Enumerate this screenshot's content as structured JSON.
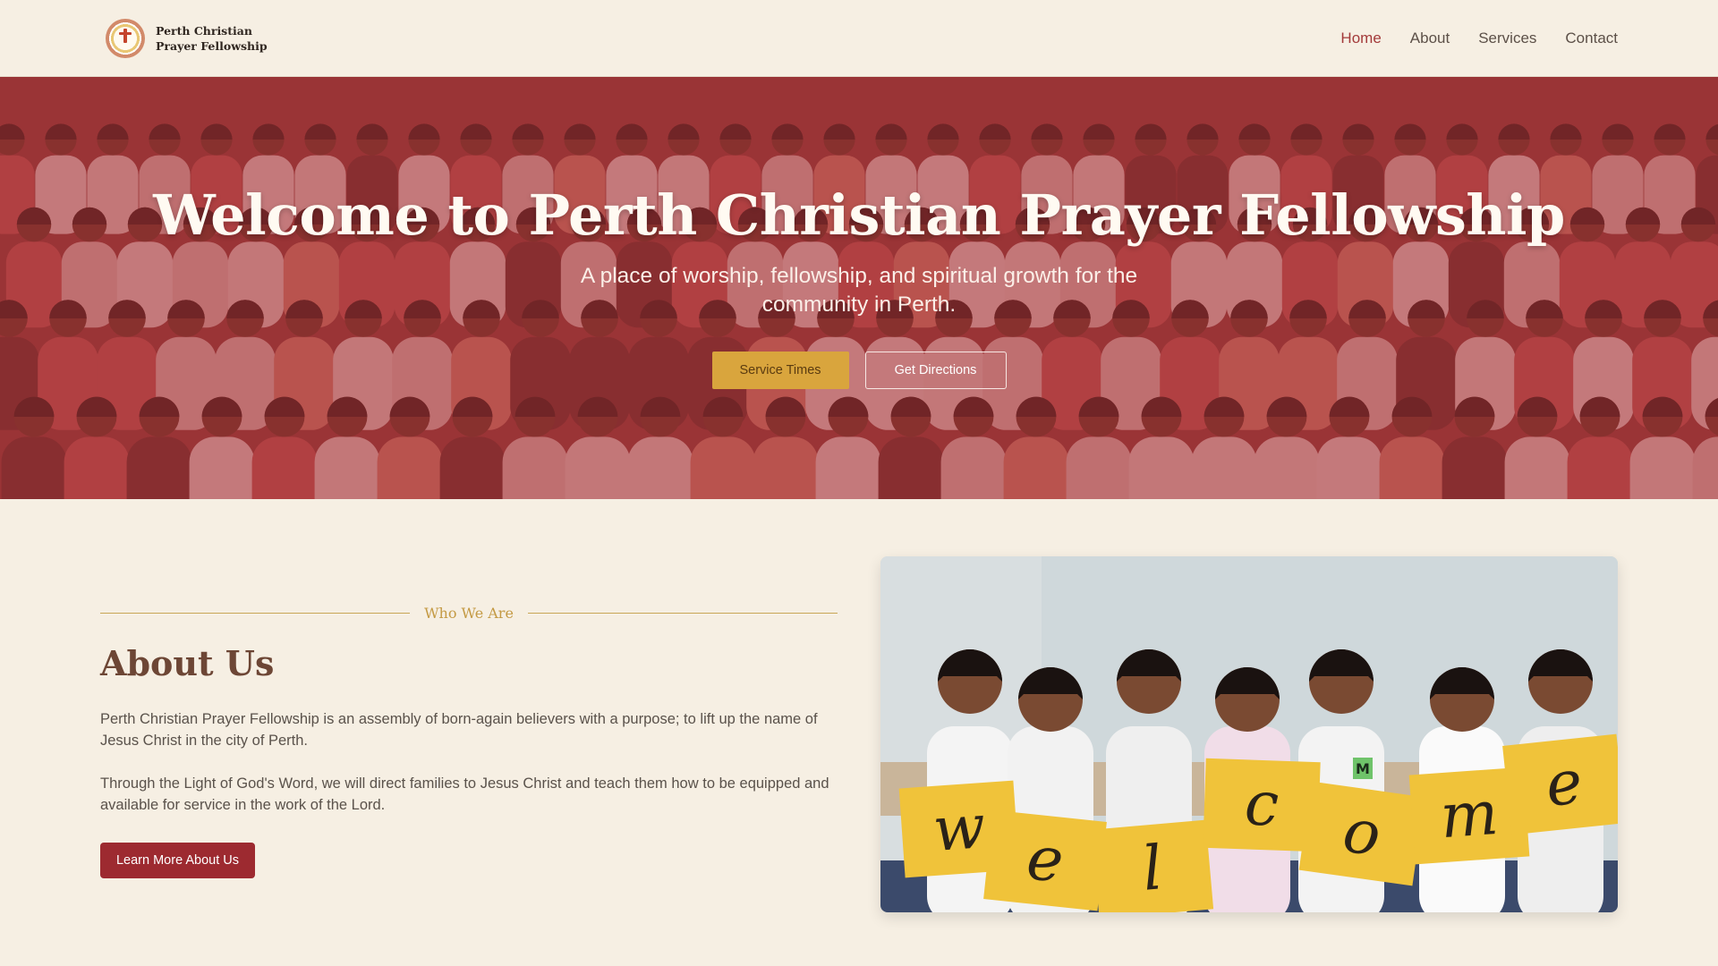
{
  "header": {
    "logo_icon": "church-seal-logo",
    "brand_line1": "Perth Christian",
    "brand_line2": "Prayer Fellowship",
    "nav": [
      {
        "label": "Home",
        "active": true
      },
      {
        "label": "About",
        "active": false
      },
      {
        "label": "Services",
        "active": false
      },
      {
        "label": "Contact",
        "active": false
      }
    ]
  },
  "hero": {
    "title": "Welcome to Perth Christian Prayer Fellowship",
    "subtitle": "A place of worship, fellowship, and spiritual growth for the community in Perth.",
    "primary_button": "Service Times",
    "secondary_button": "Get Directions",
    "overlay_color": "#a83437"
  },
  "about": {
    "eyebrow": "Who We Are",
    "title": "About Us",
    "paragraph1": "Perth Christian Prayer Fellowship is an assembly of born-again believers with a purpose; to lift up the name of Jesus Christ in the city of Perth.",
    "paragraph2": "Through the Light of God's Word, we will direct families to Jesus Christ and teach them how to be equipped and available for service in the work of the Lord.",
    "button": "Learn More About Us"
  },
  "welcome_photo": {
    "signs": [
      "w",
      "e",
      "l",
      "c",
      "o",
      "m",
      "e"
    ],
    "badge": "M"
  },
  "colors": {
    "background": "#f6efe3",
    "accent_red": "#9d2a30",
    "accent_gold": "#d9a53d",
    "nav_active": "#a33a3a"
  }
}
